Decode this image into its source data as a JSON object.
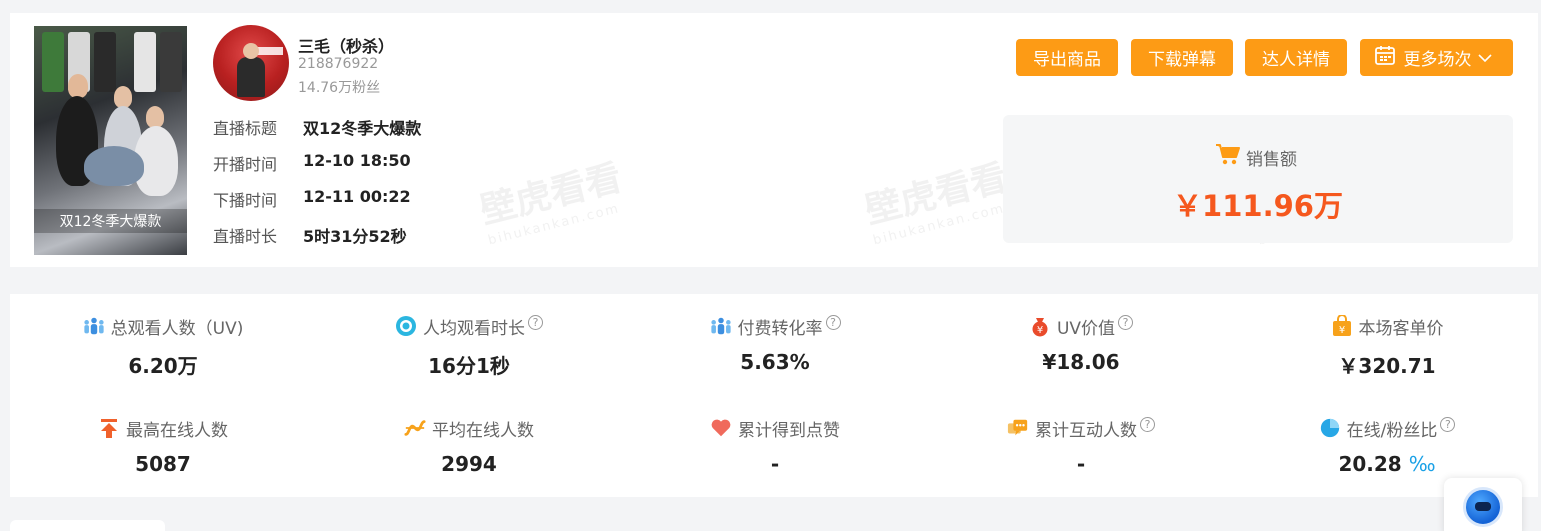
{
  "live": {
    "cover_caption": "双12冬季大爆款",
    "anchor_name": "三毛（秒杀）",
    "anchor_id": "218876922",
    "anchor_fans": "14.76万粉丝",
    "info": [
      {
        "label": "直播标题",
        "value": "双12冬季大爆款"
      },
      {
        "label": "开播时间",
        "value": "12-10 18:50"
      },
      {
        "label": "下播时间",
        "value": "12-11 00:22"
      },
      {
        "label": "直播时长",
        "value": "5时31分52秒"
      }
    ]
  },
  "actions": {
    "export_label": "导出商品",
    "download_label": "下载弹幕",
    "detail_label": "达人详情",
    "more_label": "更多场次"
  },
  "sales": {
    "label": "销售额",
    "value": "￥111.96万"
  },
  "watermark": {
    "text": "壁虎看看",
    "domain": "bihukankan.com"
  },
  "stats": [
    {
      "label": "总观看人数（UV)",
      "value": "6.20万",
      "icon": "users-icon",
      "help": false
    },
    {
      "label": "人均观看时长",
      "value": "16分1秒",
      "icon": "clock-icon",
      "help": true
    },
    {
      "label": "付费转化率",
      "value": "5.63%",
      "icon": "conversion-icon",
      "help": true
    },
    {
      "label": "UV价值",
      "value": "¥18.06",
      "icon": "yuan-bag-icon",
      "help": true
    },
    {
      "label": "本场客单价",
      "value": "￥320.71",
      "icon": "price-bag-icon",
      "help": false
    },
    {
      "label": "最高在线人数",
      "value": "5087",
      "icon": "arrow-up-icon",
      "help": false
    },
    {
      "label": "平均在线人数",
      "value": "2994",
      "icon": "average-icon",
      "help": false
    },
    {
      "label": "累计得到点赞",
      "value": "-",
      "icon": "heart-icon",
      "help": false
    },
    {
      "label": "累计互动人数",
      "value": "-",
      "icon": "chat-icon",
      "help": true
    },
    {
      "label": "在线/粉丝比",
      "value": "20.28",
      "unit": "‰",
      "icon": "pie-icon",
      "help": true
    }
  ],
  "colors": {
    "accent": "#fd9b15",
    "sales": "#f5581e",
    "unit": "#1aa1e6"
  }
}
